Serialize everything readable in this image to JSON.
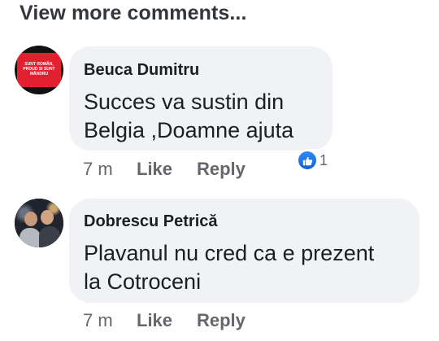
{
  "view_more": "View more comments...",
  "comments": [
    {
      "author": "Beuca Dumitru",
      "avatar_text": "SUNT ROMÂN, PROUD SI SUNT MÂNDRU",
      "text_lines": [
        "Succes va sustin din",
        "Belgia ,Doamne ajuta"
      ],
      "time": "7 m",
      "like_label": "Like",
      "reply_label": "Reply",
      "reaction_icon": "thumbs-up-icon",
      "reaction_count": "1"
    },
    {
      "author": "Dobrescu Petrică",
      "text_lines": [
        "Plavanul nu cred ca e prezent",
        "la Cotroceni"
      ],
      "time": "7 m",
      "like_label": "Like",
      "reply_label": "Reply"
    }
  ],
  "colors": {
    "bubble": "#f0f2f5",
    "meta": "#65676b",
    "like_blue": "#1877f2",
    "avatar1_red": "#e0202e"
  }
}
